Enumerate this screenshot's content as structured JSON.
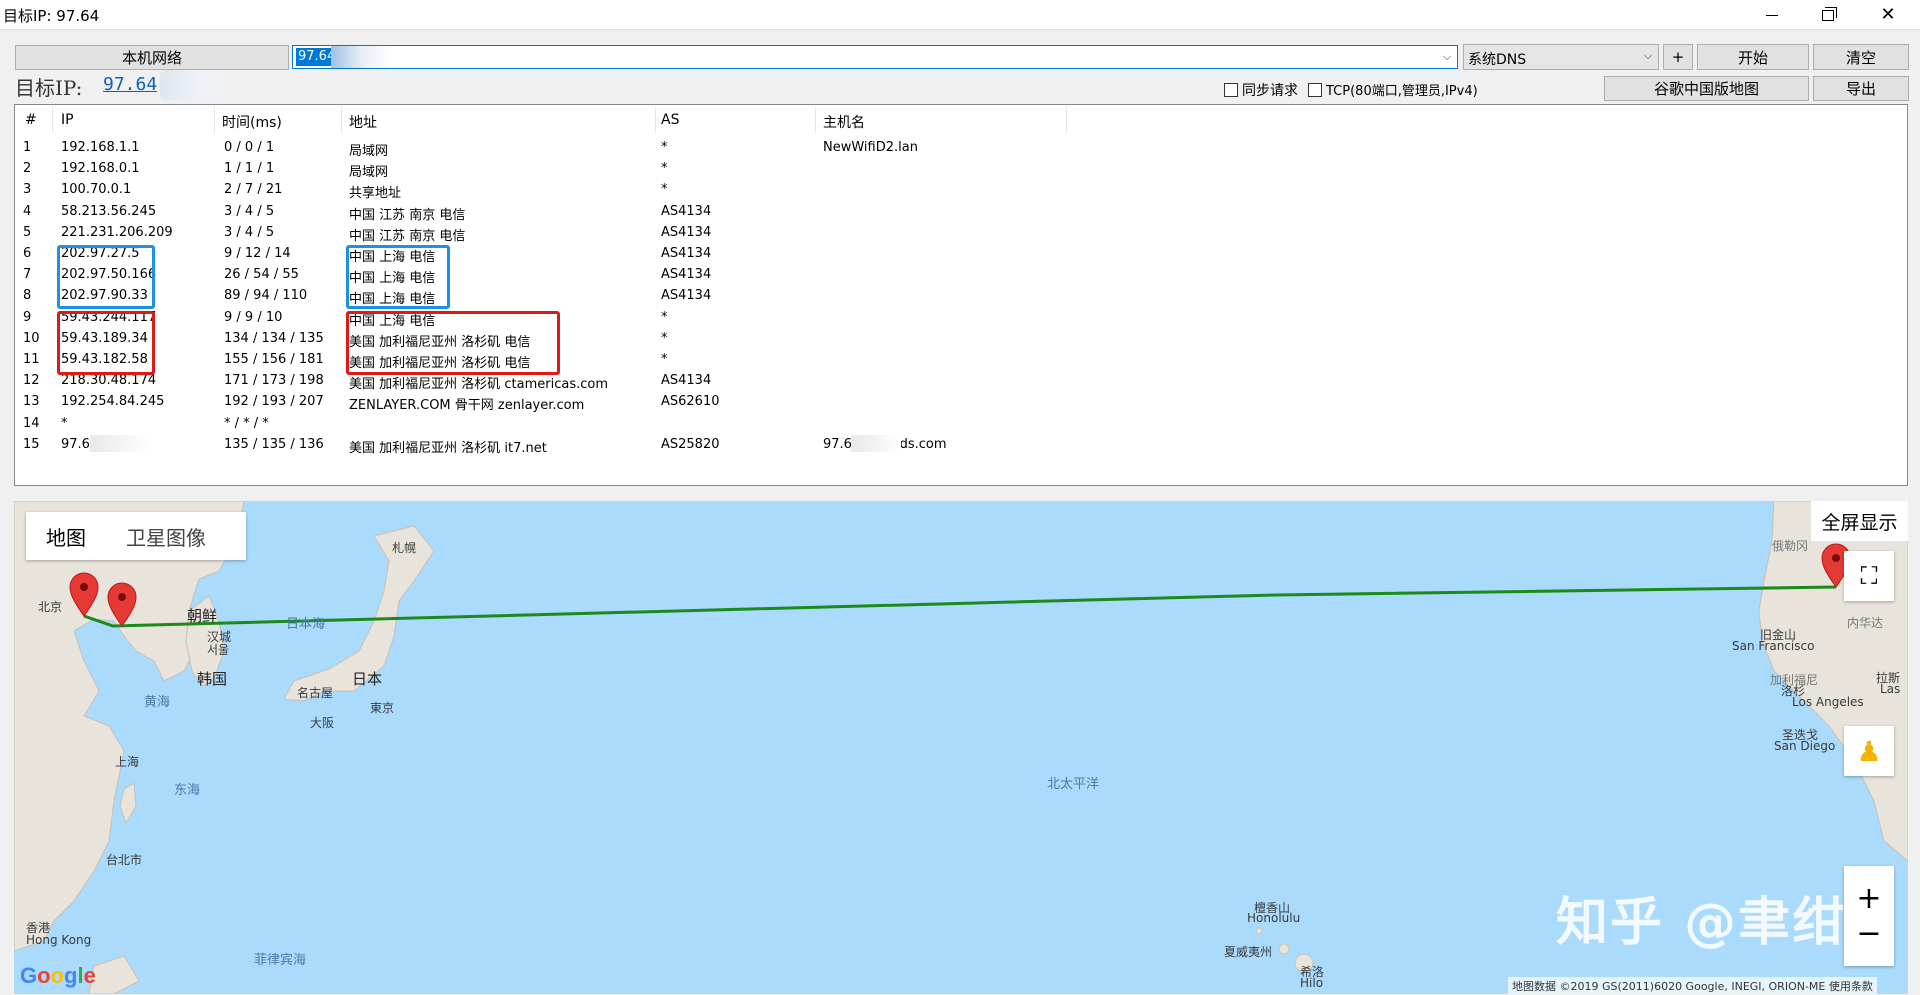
{
  "window": {
    "title": "目标IP: 97.64"
  },
  "toolbar": {
    "local_network_btn": "本机网络",
    "ip_input_value": "97.64",
    "dns_value": "系统DNS",
    "plus_btn": "+",
    "start_btn": "开始",
    "clear_btn": "清空",
    "google_map_btn": "谷歌中国版地图",
    "export_btn": "导出",
    "sync_request": "同步请求",
    "tcp_option": "TCP(80端口,管理员,IPv4)"
  },
  "target": {
    "label": "目标IP:",
    "ip": "97.64"
  },
  "table": {
    "headers": [
      "#",
      "IP",
      "时间(ms)",
      "地址",
      "AS",
      "主机名"
    ],
    "rows": [
      {
        "n": "1",
        "ip": "192.168.1.1",
        "time": "0 / 0 / 1",
        "addr": "局域网",
        "as": "*",
        "host": "NewWifiD2.lan"
      },
      {
        "n": "2",
        "ip": "192.168.0.1",
        "time": "1 / 1 / 1",
        "addr": "局域网",
        "as": "*",
        "host": ""
      },
      {
        "n": "3",
        "ip": "100.70.0.1",
        "time": "2 / 7 / 21",
        "addr": "共享地址",
        "as": "*",
        "host": ""
      },
      {
        "n": "4",
        "ip": "58.213.56.245",
        "time": "3 / 4 / 5",
        "addr": "中国 江苏 南京 电信",
        "as": "AS4134",
        "host": ""
      },
      {
        "n": "5",
        "ip": "221.231.206.209",
        "time": "3 / 4 / 5",
        "addr": "中国 江苏 南京 电信",
        "as": "AS4134",
        "host": ""
      },
      {
        "n": "6",
        "ip": "202.97.27.5",
        "time": "9 / 12 / 14",
        "addr": "中国 上海 电信",
        "as": "AS4134",
        "host": ""
      },
      {
        "n": "7",
        "ip": "202.97.50.166",
        "time": "26 / 54 / 55",
        "addr": "中国 上海 电信",
        "as": "AS4134",
        "host": ""
      },
      {
        "n": "8",
        "ip": "202.97.90.33",
        "time": "89 / 94 / 110",
        "addr": "中国 上海 电信",
        "as": "AS4134",
        "host": ""
      },
      {
        "n": "9",
        "ip": "59.43.244.117",
        "time": "9 / 9 / 10",
        "addr": "中国 上海 电信",
        "as": "*",
        "host": ""
      },
      {
        "n": "10",
        "ip": "59.43.189.34",
        "time": "134 / 134 / 135",
        "addr": "美国 加利福尼亚州 洛杉矶 电信",
        "as": "*",
        "host": ""
      },
      {
        "n": "11",
        "ip": "59.43.182.58",
        "time": "155 / 156 / 181",
        "addr": "美国 加利福尼亚州 洛杉矶 电信",
        "as": "*",
        "host": ""
      },
      {
        "n": "12",
        "ip": "218.30.48.174",
        "time": "171 / 173 / 198",
        "addr": "美国 加利福尼亚州 洛杉矶 ctamericas.com",
        "as": "AS4134",
        "host": ""
      },
      {
        "n": "13",
        "ip": "192.254.84.245",
        "time": "192 / 193 / 207",
        "addr": "ZENLAYER.COM 骨干网 zenlayer.com",
        "as": "AS62610",
        "host": ""
      },
      {
        "n": "14",
        "ip": "*",
        "time": "* / * / *",
        "addr": "",
        "as": "",
        "host": ""
      },
      {
        "n": "15",
        "ip": "97.64",
        "time": "135 / 135 / 136",
        "addr": "美国 加利福尼亚州 洛杉矶 it7.net",
        "as": "AS25820",
        "host": "97.6 16clouds.com"
      }
    ]
  },
  "map": {
    "tab_map": "地图",
    "tab_satellite": "卫星图像",
    "fullscreen": "全屏显示",
    "labels": {
      "beijing": "北京",
      "korea_n": "朝鲜",
      "hancheng": "汉城",
      "seoul": "서울",
      "korea": "韩国",
      "yellow_sea": "黄海",
      "sea_of_japan": "日本海",
      "japan": "日本",
      "sapporo": "札幌",
      "nagoya": "名古屋",
      "tokyo": "東京",
      "osaka": "大阪",
      "east_sea": "东海",
      "shanghai": "上海",
      "taipei": "台北市",
      "hongkong_cn": "香港",
      "hongkong": "Hong Kong",
      "philippine_sea": "菲律宾海",
      "north_pacific": "北太平洋",
      "honolulu_cn": "檀香山",
      "honolulu": "Honolulu",
      "hawaii": "夏威夷州",
      "hilo_cn": "希洛",
      "hilo": "Hilo",
      "sf_cn": "旧金山",
      "sf": "San Francisco",
      "la": "Los Angeles",
      "la_cn": "洛杉",
      "sd_cn": "圣迭戈",
      "sd": "San Diego",
      "california": "加利福尼",
      "nevada": "内华达",
      "oregon": "俄勒冈",
      "lasvegas_cn": "拉斯",
      "lasvegas": "Las"
    },
    "google": "Google",
    "copyright": "地图数据 ©2019 GS(2011)6020 Google, INEGI, ORION-ME    使用条款",
    "watermark": "知乎 @聿绀",
    "route_color": "#1a8a1a",
    "marker_color": "#e53935"
  }
}
